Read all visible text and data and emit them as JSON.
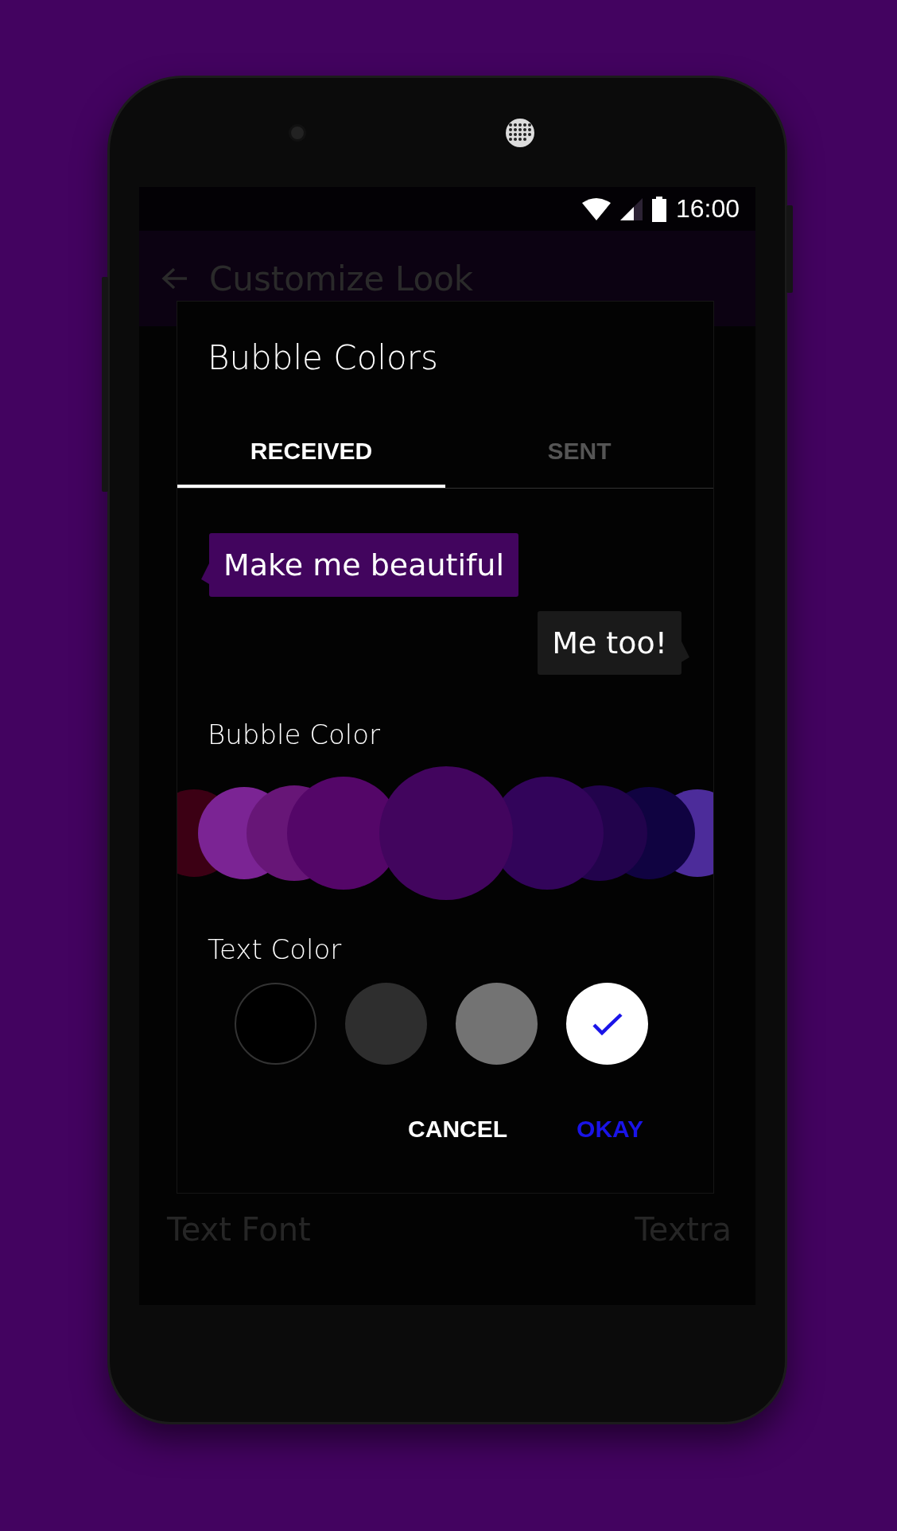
{
  "status_bar": {
    "time": "16:00"
  },
  "app_bar": {
    "title": "Customize Look"
  },
  "background_sections": [
    {
      "rows": [
        {
          "label": "Text Font",
          "value": "Textra"
        }
      ]
    }
  ],
  "dialog": {
    "title": "Bubble Colors",
    "tabs": [
      {
        "label": "RECEIVED",
        "selected": true
      },
      {
        "label": "SENT",
        "selected": false
      }
    ],
    "preview": [
      {
        "kind": "received",
        "text": "Make me beautiful"
      },
      {
        "kind": "sent",
        "text": "Me too!"
      }
    ],
    "bubble_color_label": "Bubble Color",
    "bubble_colors": [
      {
        "color": "#3c0014",
        "selected": false
      },
      {
        "color": "#7b2494",
        "selected": false
      },
      {
        "color": "#671677",
        "selected": false
      },
      {
        "color": "#540668",
        "selected": false
      },
      {
        "color": "#42055e",
        "selected": true
      },
      {
        "color": "#32045a",
        "selected": false
      },
      {
        "color": "#22034c",
        "selected": false
      },
      {
        "color": "#100341",
        "selected": false
      },
      {
        "color": "#4c2c9a",
        "selected": false
      }
    ],
    "text_color_label": "Text Color",
    "text_colors": [
      {
        "color": "#000000",
        "selected": false
      },
      {
        "color": "#2e2e2e",
        "selected": false
      },
      {
        "color": "#737373",
        "selected": false
      },
      {
        "color": "#ffffff",
        "selected": true
      }
    ],
    "buttons": [
      {
        "kind": "neutral",
        "label": "CANCEL"
      },
      {
        "kind": "primary",
        "label": "OKAY"
      }
    ]
  }
}
